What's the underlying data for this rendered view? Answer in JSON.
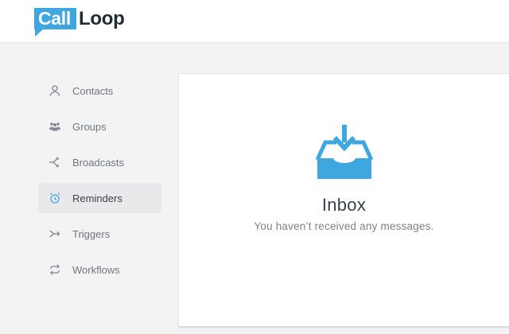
{
  "brand": {
    "part1": "Call",
    "part2": "Loop"
  },
  "colors": {
    "accent": "#3fa7e0",
    "text": "#39424a",
    "muted": "#7b838b"
  },
  "nav": {
    "items": [
      {
        "label": "Contacts",
        "icon": "user-icon",
        "active": false
      },
      {
        "label": "Groups",
        "icon": "people-group-icon",
        "active": false
      },
      {
        "label": "Broadcasts",
        "icon": "broadcast-icon",
        "active": false
      },
      {
        "label": "Reminders",
        "icon": "alarm-clock-icon",
        "active": true
      },
      {
        "label": "Triggers",
        "icon": "trigger-arrow-icon",
        "active": false
      },
      {
        "label": "Workflows",
        "icon": "workflow-loop-icon",
        "active": false
      }
    ]
  },
  "main": {
    "empty_state": {
      "icon": "inbox-icon",
      "title": "Inbox",
      "subtitle": "You haven’t received any messages."
    }
  }
}
